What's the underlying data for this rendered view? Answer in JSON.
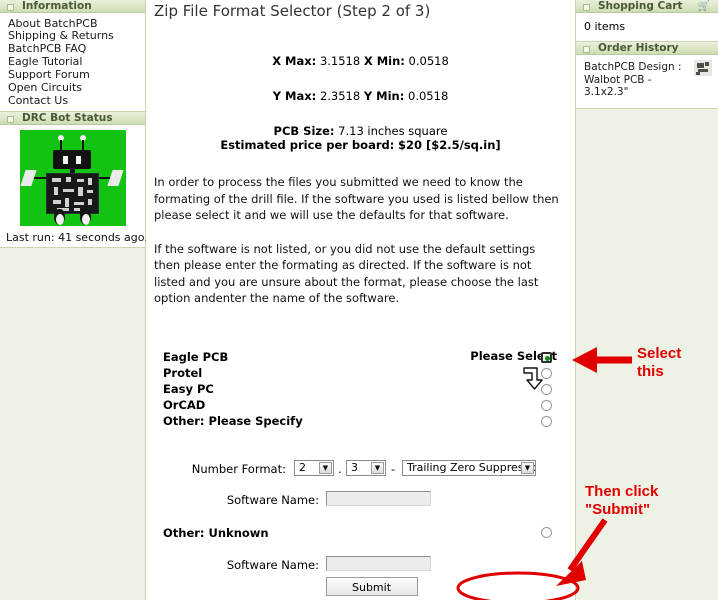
{
  "sidebar_left": {
    "information": {
      "title": "Information",
      "items": [
        "About BatchPCB",
        "Shipping & Returns",
        "BatchPCB FAQ",
        "Eagle Tutorial",
        "Support Forum",
        "Open Circuits",
        "Contact Us"
      ]
    },
    "drc": {
      "title": "DRC Bot Status",
      "image_alt": "robot-mascot",
      "background_color": "#12c312",
      "last_run": "Last run: 41 seconds ago."
    }
  },
  "sidebar_right": {
    "cart": {
      "title": "Shopping Cart",
      "icon": "cart-icon",
      "items_text": "0 items"
    },
    "order_history": {
      "title": "Order History",
      "entries": [
        "BatchPCB Design : Walbot PCB - 3.1x2.3\""
      ]
    }
  },
  "main": {
    "title": "Zip File Format Selector (Step 2 of 3)",
    "specs": [
      {
        "label1": "X Max:",
        "value1": "3.1518",
        "label2": "X Min:",
        "value2": "0.0518"
      },
      {
        "label1": "Y Max:",
        "value1": "2.3518",
        "label2": "Y Min:",
        "value2": "0.0518"
      }
    ],
    "pcb_size_label": "PCB Size:",
    "pcb_size_value": "7.13 inches square",
    "price_label": "Estimated price per board:",
    "price_value": "$20 [$2.5/sq.in]",
    "paragraph1": "In order to process the files you submitted we need to know the formating of the drill file. If the software you used is listed bellow then please select it and we will use the defaults for that software.",
    "paragraph2": "If the software is not listed, or you did not use the default settings then please enter the formating as directed. If the software is not listed and you are unsure about the format, please choose the last option andenter the name of the software.",
    "please_select": "Please Select",
    "choices": [
      {
        "label": "Eagle PCB",
        "selected": true
      },
      {
        "label": "Protel",
        "selected": false
      },
      {
        "label": "Easy PC",
        "selected": false
      },
      {
        "label": "OrCAD",
        "selected": false
      },
      {
        "label": "Other: Please Specify",
        "selected": false
      }
    ],
    "number_format": {
      "label": "Number Format:",
      "integer_digits": "2",
      "separator": ".",
      "decimal_digits": "3",
      "dash": "-",
      "zero_mode": "Trailing Zero Suppression"
    },
    "software_name_label_1": "Software Name:",
    "software_name_value_1": "",
    "other_unknown_label": "Other: Unknown",
    "software_name_label_2": "Software Name:",
    "software_name_value_2": "",
    "submit_label": "Submit"
  },
  "annotations": {
    "select_this_line1": "Select",
    "select_this_line2": "this",
    "then_click_line1": "Then click",
    "then_click_line2": "\"Submit\"",
    "color": "#e00000"
  }
}
